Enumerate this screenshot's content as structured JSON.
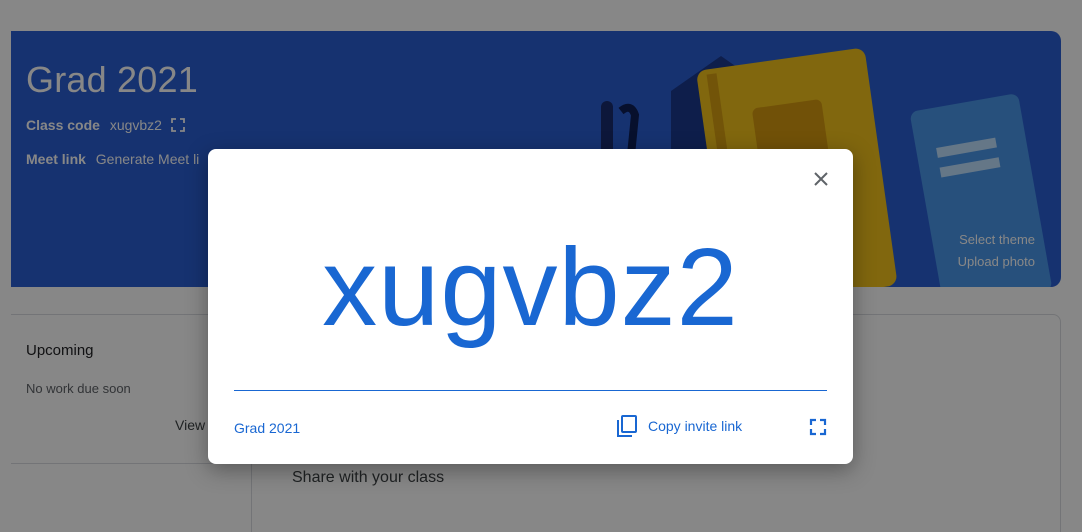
{
  "banner": {
    "title": "Grad 2021",
    "class_code_label": "Class code",
    "class_code_value": "xugvbz2",
    "meet_label": "Meet link",
    "meet_value": "Generate Meet li",
    "select_theme": "Select theme",
    "upload_photo": "Upload photo"
  },
  "upcoming": {
    "title": "Upcoming",
    "empty_text": "No work due soon",
    "view_all": "View all"
  },
  "stream": {
    "share_placeholder": "Share with your class"
  },
  "dialog": {
    "code": "xugvbz2",
    "class_name": "Grad 2021",
    "copy_invite_label": "Copy invite link",
    "icons": [
      "close-icon",
      "copy-icon",
      "fullscreen-icon"
    ]
  },
  "colors": {
    "banner_bg": "#2a5fd4",
    "accent": "#1967d2"
  }
}
